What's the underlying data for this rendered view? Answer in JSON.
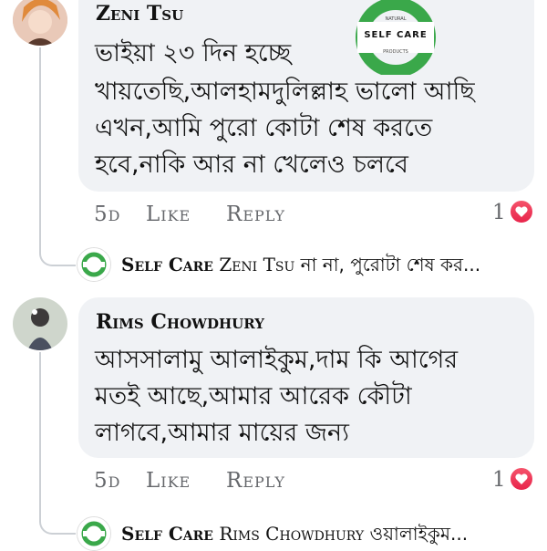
{
  "comments": [
    {
      "author": "Zeni Tsu",
      "lines": [
        "ভাইয়া ২৩ দিন হচ্ছে",
        "খায়তেছি,আলহামদুলিল্লাহ ভালো আছি",
        "এখন,আমি পুরো কোটা শেষ করতে",
        "হবে,নাকি আর না খেলেও চলবে"
      ],
      "time": "5d",
      "like": "Like",
      "reply": "Reply",
      "reaction_count": "1",
      "reply_preview": {
        "author": "Self Care",
        "mention": "Zeni Tsu",
        "text": "না না, পুরোটা শেষ কর..."
      }
    },
    {
      "author": "Rims Chowdhury",
      "lines": [
        "আসসালামু আলাইকুম,দাম কি আগের",
        "মতই আছে,আমার আরেক কৌটা",
        "লাগবে,আমার মায়ের জন্য"
      ],
      "time": "5d",
      "like": "Like",
      "reply": "Reply",
      "reaction_count": "1",
      "reply_preview": {
        "author": "Self Care",
        "mention": "Rims Chowdhury",
        "text": "ওয়ালাইকুম..."
      }
    }
  ],
  "logo": {
    "top": "NATURAL",
    "main": "SELF CARE",
    "bottom": "PRODUCTS"
  },
  "colors": {
    "bubble": "#f0f2f5",
    "meta": "#65676b",
    "heart": "#e8244b",
    "logo_green": "#3aa84a"
  }
}
